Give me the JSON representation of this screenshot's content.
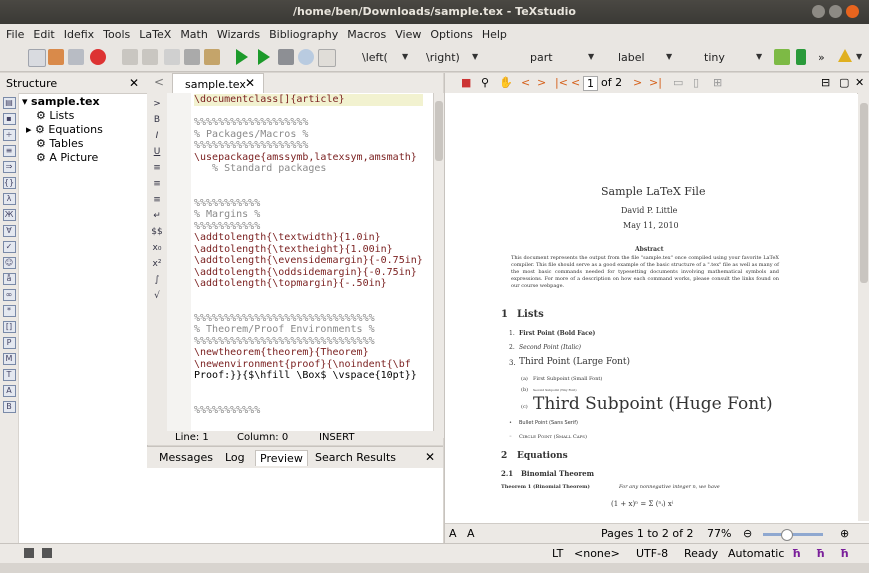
{
  "window": {
    "title": "/home/ben/Downloads/sample.tex - TeXstudio"
  },
  "menu": [
    "File",
    "Edit",
    "Idefix",
    "Tools",
    "LaTeX",
    "Math",
    "Wizards",
    "Bibliography",
    "Macros",
    "View",
    "Options",
    "Help"
  ],
  "toolbar": {
    "left_bracket": "\\left(",
    "right_bracket": "\\right)",
    "sectioning": "part",
    "reference": "label",
    "size": "tiny",
    "more": "»"
  },
  "structure": {
    "title": "Structure",
    "close": "✕",
    "root": "sample.tex",
    "items": [
      "Lists",
      "Equations",
      "Tables",
      "A Picture"
    ]
  },
  "editor": {
    "tab_label": "sample.tex",
    "tab_close": "✕",
    "lines": [
      "\\documentclass[]{article}",
      "",
      "%%%%%%%%%%%%%%%%%%%",
      "% Packages/Macros %",
      "%%%%%%%%%%%%%%%%%%%",
      "\\usepackage{amssymb,latexsym,amsmath}",
      "   % Standard packages",
      "",
      "",
      "%%%%%%%%%%%",
      "% Margins %",
      "%%%%%%%%%%%",
      "\\addtolength{\\textwidth}{1.0in}",
      "\\addtolength{\\textheight}{1.00in}",
      "\\addtolength{\\evensidemargin}{-0.75in}",
      "\\addtolength{\\oddsidemargin}{-0.75in}",
      "\\addtolength{\\topmargin}{-.50in}",
      "",
      "",
      "%%%%%%%%%%%%%%%%%%%%%%%%%%%%%%",
      "% Theorem/Proof Environments %",
      "%%%%%%%%%%%%%%%%%%%%%%%%%%%%%%",
      "\\newtheorem{theorem}{Theorem}",
      "\\newenvironment{proof}{\\noindent{\\bf",
      "Proof:}}{$\\hfill \\Box$ \\vspace{10pt}}",
      "",
      "",
      "%%%%%%%%%%%"
    ],
    "status": {
      "line": "Line: 1",
      "column": "Column: 0",
      "mode": "INSERT"
    }
  },
  "bottom_tabs": [
    "Messages",
    "Log",
    "Preview",
    "Search Results"
  ],
  "bottom_close": "✕",
  "viewer": {
    "page_input": "1",
    "page_of": "of 2",
    "pages_label": "Pages 1 to 2 of 2",
    "zoom": "77%",
    "pdf": {
      "title": "Sample LaTeX File",
      "author": "David P. Little",
      "date": "May 11, 2010",
      "abstract_heading": "Abstract",
      "abstract": "This document represents the output from the file \"sample.tex\" once compiled using your favorite LaTeX compiler. This file should serve as a good example of the basic structure of a \".tex\" file as well as many of the most basic commands needed for typesetting documents involving mathematical symbols and expressions. For more of a description on how each command works, please consult the links found on our course webpage.",
      "s1_num": "1",
      "s1": "Lists",
      "items": [
        {
          "num": "1.",
          "text": "First Point (Bold Face)"
        },
        {
          "num": "2.",
          "text": "Second Point (Italic)"
        },
        {
          "num": "3.",
          "text": "Third Point (Large Font)"
        }
      ],
      "subitems": [
        {
          "num": "(a)",
          "text": "First Subpoint (Small Font)"
        },
        {
          "num": "(b)",
          "text": "Second Subpoint (Tiny Font)"
        },
        {
          "num": "(c)",
          "text": "Third Subpoint (Huge Font)"
        }
      ],
      "bullets": [
        "Bullet Point (Sans Serif)",
        "Circle Point (Small Caps)"
      ],
      "s2_num": "2",
      "s2": "Equations",
      "s21_num": "2.1",
      "s21": "Binomial Theorem",
      "theorem_label": "Theorem 1 (Binomial Theorem)",
      "theorem_text": "For any nonnegative integer n, we have",
      "formula": "(1 + x)ⁿ = Σ (ⁿᵢ) xⁱ"
    }
  },
  "status_bar": {
    "language": "<none>",
    "encoding": "UTF-8",
    "state": "Ready",
    "mode": "Automatic"
  },
  "colors": {
    "accent": "#e8641e",
    "keyword": "#7a1f1f",
    "arg": "#1a6e1a",
    "comment": "#8a8a8a"
  }
}
